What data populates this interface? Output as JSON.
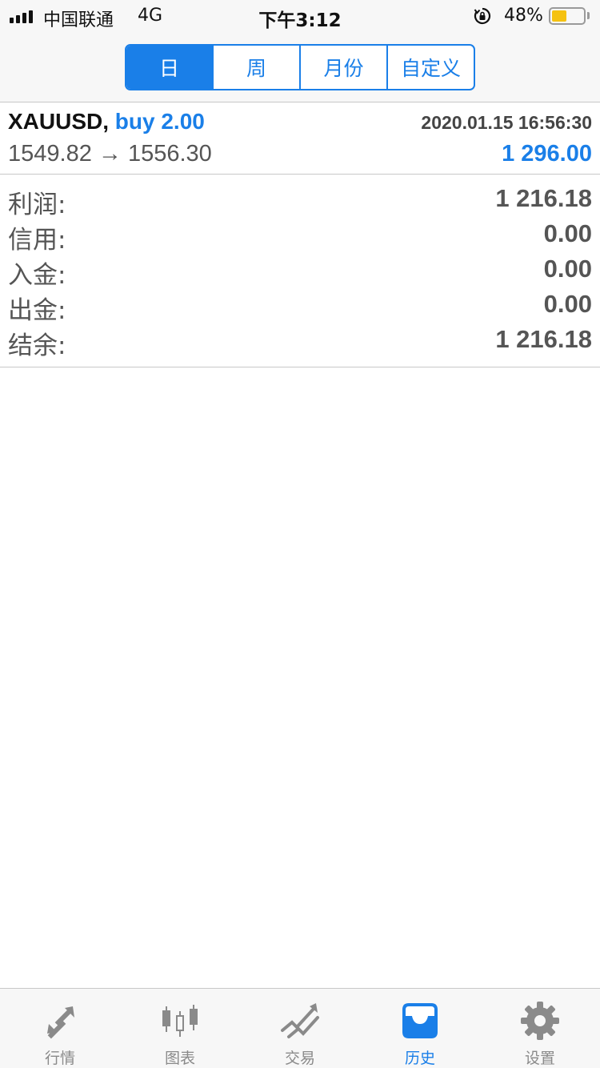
{
  "status_bar": {
    "carrier": "中国联通",
    "network": "4G",
    "time": "下午3:12",
    "battery_percent_text": "48%",
    "battery_level": 0.48,
    "battery_color": "#f5c211"
  },
  "period_tabs": [
    {
      "label": "日",
      "active": true
    },
    {
      "label": "周",
      "active": false
    },
    {
      "label": "月份",
      "active": false
    },
    {
      "label": "自定义",
      "active": false
    }
  ],
  "deal": {
    "symbol": "XAUUSD,",
    "action": "buy 2.00",
    "datetime": "2020.01.15 16:56:30",
    "price_open": "1549.82",
    "arrow": "→",
    "price_close": "1556.30",
    "profit": "1 296.00"
  },
  "summary": [
    {
      "label": "利润:",
      "value": "1 216.18"
    },
    {
      "label": "信用:",
      "value": "0.00"
    },
    {
      "label": "入金:",
      "value": "0.00"
    },
    {
      "label": "出金:",
      "value": "0.00"
    },
    {
      "label": "结余:",
      "value": "1 216.18"
    }
  ],
  "tab_bar": [
    {
      "label": "行情",
      "icon": "quotes-arrows-icon",
      "active": false
    },
    {
      "label": "图表",
      "icon": "candlestick-chart-icon",
      "active": false
    },
    {
      "label": "交易",
      "icon": "trade-trend-icon",
      "active": false
    },
    {
      "label": "历史",
      "icon": "history-inbox-icon",
      "active": true
    },
    {
      "label": "设置",
      "icon": "gear-icon",
      "active": false
    }
  ],
  "colors": {
    "accent": "#1a7fe8",
    "inactive": "#8a8a8a"
  }
}
